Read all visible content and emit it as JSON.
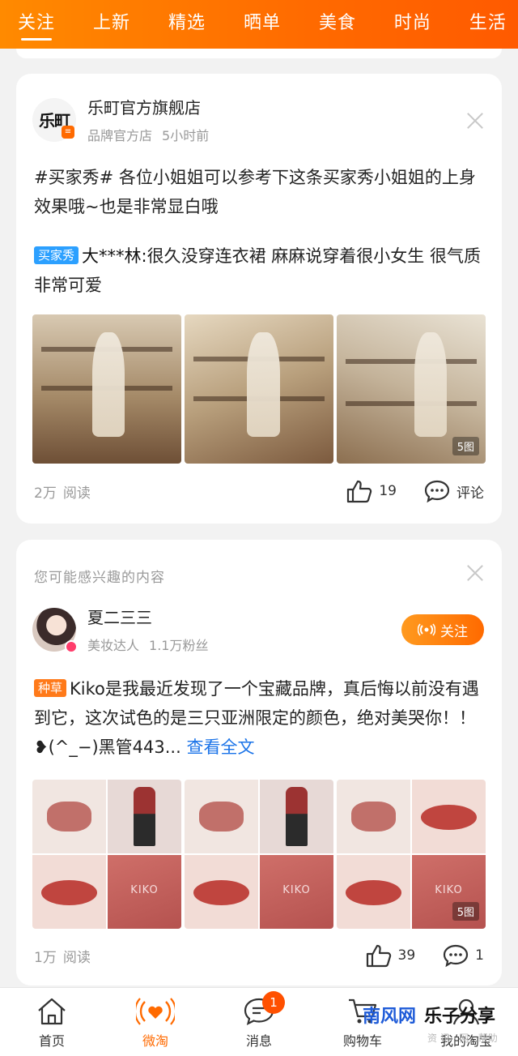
{
  "tabs": [
    "关注",
    "上新",
    "精选",
    "晒单",
    "美食",
    "时尚",
    "生活"
  ],
  "post1": {
    "shop_name": "乐町官方旗舰店",
    "logo_text": "乐町",
    "shop_type": "品牌官方店",
    "time": "5小时前",
    "body": "#买家秀# 各位小姐姐可以参考下这条买家秀小姐姐的上身效果哦~也是非常显白哦",
    "tag": "买家秀",
    "comment_user": "大***林:",
    "comment_text": "很久没穿连衣裙 麻麻说穿着很小女生 很气质 非常可爱",
    "photo_count": "5图",
    "reads_num": "2万",
    "reads_label": "阅读",
    "likes": "19",
    "comment_label": "评论"
  },
  "post2": {
    "section_title": "您可能感兴趣的内容",
    "user_name": "夏二三三",
    "user_role": "美妆达人",
    "fans": "1.1万粉丝",
    "follow_label": "关注",
    "tag": "种草",
    "body": "Kiko是我最近发现了一个宝藏品牌，真后悔以前没有遇到它，这次试色的是三只亚洲限定的颜色，绝对美哭你！！❥(^_−)黑管443...",
    "more_label": " 查看全文",
    "pack_label_1": "KIKO",
    "pack_label_2": "KIKO",
    "pack_label_3": "KIKO",
    "photo_count": "5图",
    "reads_num": "1万",
    "reads_label": "阅读",
    "likes": "39",
    "comments": "1"
  },
  "bottom_nav": [
    {
      "label": "首页",
      "icon": "home-icon"
    },
    {
      "label": "微淘",
      "icon": "heart-broadcast-icon"
    },
    {
      "label": "消息",
      "icon": "message-icon",
      "badge": "1"
    },
    {
      "label": "购物车",
      "icon": "cart-icon"
    },
    {
      "label": "我的淘宝",
      "icon": "user-icon"
    }
  ],
  "watermark": {
    "part1": "南风网",
    "part2": "乐子分享",
    "sub": "资 讯 · 网 · 帮助"
  },
  "colors": {
    "accent": "#ff6a00",
    "link": "#1a73e8",
    "tag_blue": "#2ca0ff",
    "tag_orange": "#ff7a1a"
  }
}
